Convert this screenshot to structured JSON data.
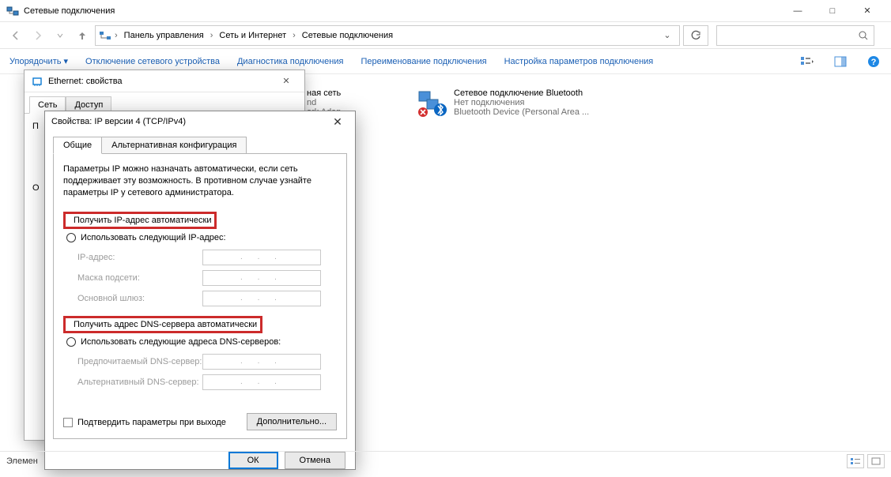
{
  "window": {
    "title": "Сетевые подключения",
    "minimize": "—",
    "maximize": "□",
    "close": "✕"
  },
  "address": {
    "crumb1": "Панель управления",
    "crumb2": "Сеть и Интернет",
    "crumb3": "Сетевые подключения"
  },
  "toolbar": {
    "organize": "Упорядочить ▾",
    "disable": "Отключение сетевого устройства",
    "diagnose": "Диагностика подключения",
    "rename": "Переименование подключения",
    "settings": "Настройка параметров подключения"
  },
  "connections": {
    "local": {
      "name_tail": "ная сеть",
      "line2_tail": "nd",
      "line3_tail": "ork Adap..."
    },
    "bt": {
      "name": "Сетевое подключение Bluetooth",
      "line2": "Нет подключения",
      "line3": "Bluetooth Device (Personal Area ..."
    }
  },
  "statusbar": {
    "text": "Элемен"
  },
  "dlg_eth": {
    "title": "Ethernet: свойства",
    "tab_net": "Сеть",
    "tab_access": "Доступ",
    "connect_label": "П",
    "o_label": "О"
  },
  "dlg_ip": {
    "title": "Свойства: IP версии 4 (TCP/IPv4)",
    "tab_general": "Общие",
    "tab_alt": "Альтернативная конфигурация",
    "intro": "Параметры IP можно назначать автоматически, если сеть поддерживает эту возможность. В противном случае узнайте параметры IP у сетевого администратора.",
    "auto_ip": "Получить IP-адрес автоматически",
    "manual_ip": "Использовать следующий IP-адрес:",
    "ip_label": "IP-адрес:",
    "mask_label": "Маска подсети:",
    "gw_label": "Основной шлюз:",
    "auto_dns": "Получить адрес DNS-сервера автоматически",
    "manual_dns": "Использовать следующие адреса DNS-серверов:",
    "dns1_label": "Предпочитаемый DNS-сервер:",
    "dns2_label": "Альтернативный DNS-сервер:",
    "confirm": "Подтвердить параметры при выходе",
    "advanced": "Дополнительно...",
    "ok": "ОК",
    "cancel": "Отмена",
    "ip_placeholder": ".   .   ."
  }
}
